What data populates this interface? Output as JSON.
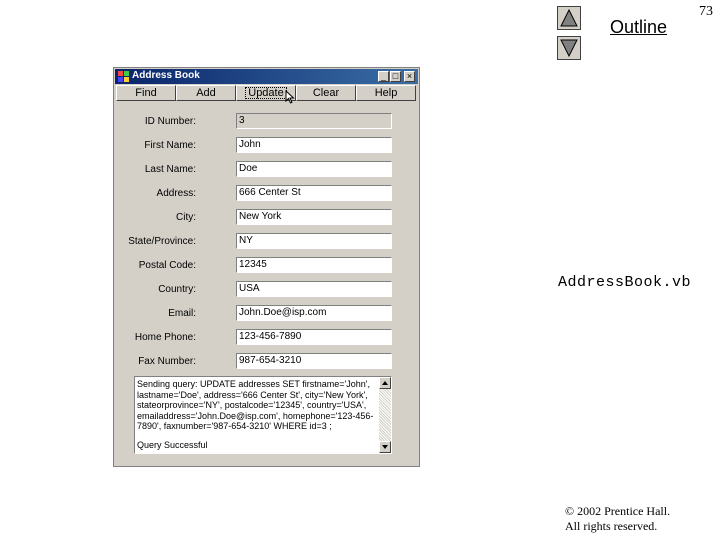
{
  "slide": {
    "outline_label": "Outline",
    "page_number": "73",
    "file_label": "AddressBook.vb",
    "copyright_line1": "© 2002 Prentice Hall.",
    "copyright_line2": "All rights reserved."
  },
  "window": {
    "title": "Address Book",
    "controls": {
      "minimize": "_",
      "maximize": "□",
      "close": "×"
    }
  },
  "toolbar": {
    "buttons": [
      "Find",
      "Add",
      "Update",
      "Clear",
      "Help"
    ]
  },
  "form": {
    "fields": [
      {
        "label": "ID Number:",
        "value": "3"
      },
      {
        "label": "First Name:",
        "value": "John"
      },
      {
        "label": "Last Name:",
        "value": "Doe"
      },
      {
        "label": "Address:",
        "value": "666 Center St"
      },
      {
        "label": "City:",
        "value": "New York"
      },
      {
        "label": "State/Province:",
        "value": "NY"
      },
      {
        "label": "Postal Code:",
        "value": "12345"
      },
      {
        "label": "Country:",
        "value": "USA"
      },
      {
        "label": "Email:",
        "value": "John.Doe@isp.com"
      },
      {
        "label": "Home Phone:",
        "value": "123-456-7890"
      },
      {
        "label": "Fax Number:",
        "value": "987-654-3210"
      }
    ]
  },
  "status": {
    "query": "Sending query: UPDATE addresses SET firstname='John', lastname='Doe', address='666 Center St', city='New York', stateorprovince='NY', postalcode='12345', country='USA', emailaddress='John.Doe@isp.com', homephone='123-456-7890', faxnumber='987-654-3210' WHERE id=3 ;",
    "result": "Query Successful"
  }
}
